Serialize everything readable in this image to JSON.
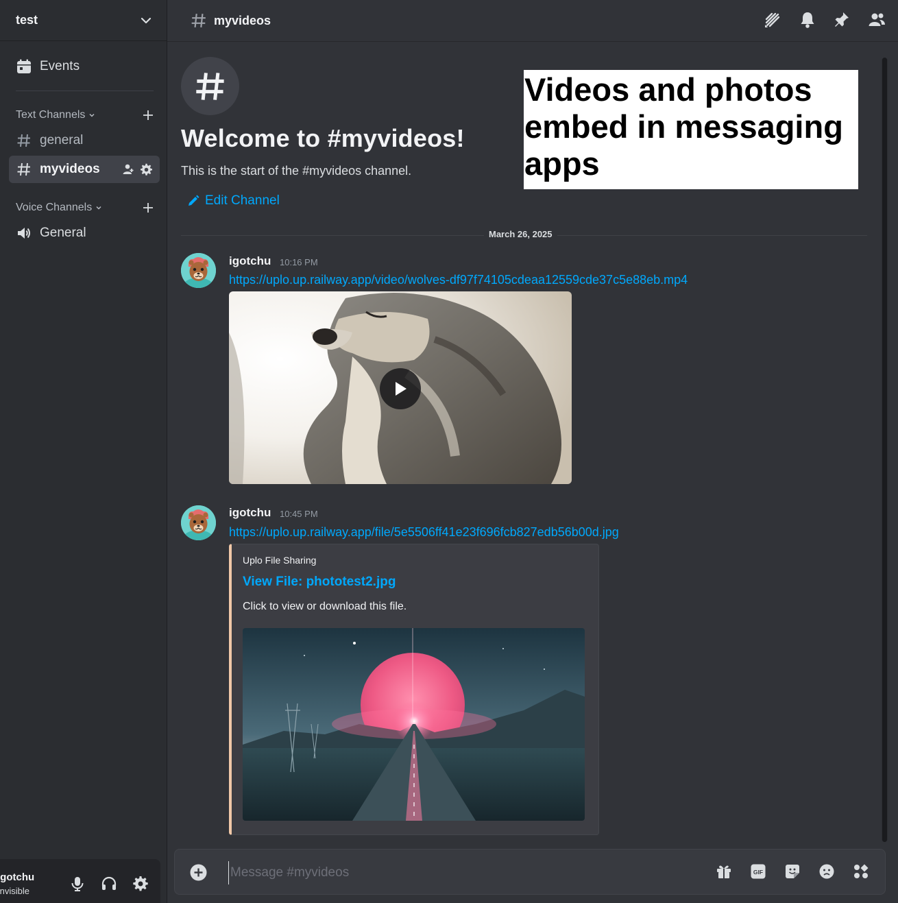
{
  "server": {
    "name": "test"
  },
  "sidebar": {
    "events_label": "Events",
    "text_category": "Text Channels",
    "voice_category": "Voice Channels",
    "text_channels": [
      {
        "name": "general",
        "active": false
      },
      {
        "name": "myvideos",
        "active": true
      }
    ],
    "voice_channels": [
      {
        "name": "General"
      }
    ]
  },
  "user": {
    "name": "igotchu",
    "status": "Invisible"
  },
  "header": {
    "channel_name": "myvideos",
    "icons": [
      "threads-icon",
      "bell-icon",
      "pin-icon",
      "members-icon"
    ]
  },
  "welcome": {
    "title": "Welcome to #myvideos!",
    "subtitle": "This is the start of the #myvideos channel.",
    "edit_label": "Edit Channel"
  },
  "overlay": {
    "text": "Videos and photos embed in messaging apps"
  },
  "date_divider": "March 26, 2025",
  "messages": [
    {
      "author": "igotchu",
      "time": "10:16 PM",
      "link": "https://uplo.up.railway.app/video/wolves-df97f74105cdeaa12559cde37c5e88eb.mp4",
      "attachment": "video"
    },
    {
      "author": "igotchu",
      "time": "10:45 PM",
      "link": "https://uplo.up.railway.app/file/5e5506ff41e23f696fcb827edb56b00d.jpg",
      "embed": {
        "provider": "Uplo File Sharing",
        "title": "View File: phototest2.jpg",
        "description": "Click to view or download this file.",
        "accent_color": "#f1c8a8"
      }
    }
  ],
  "composer": {
    "placeholder": "Message #myvideos",
    "gif_label": "GIF",
    "tools": [
      "gift-icon",
      "gif-icon",
      "sticker-icon",
      "emoji-icon",
      "apps-icon"
    ]
  },
  "colors": {
    "link": "#00a8fc",
    "background": "#313338",
    "sidebar": "#2b2d31"
  }
}
